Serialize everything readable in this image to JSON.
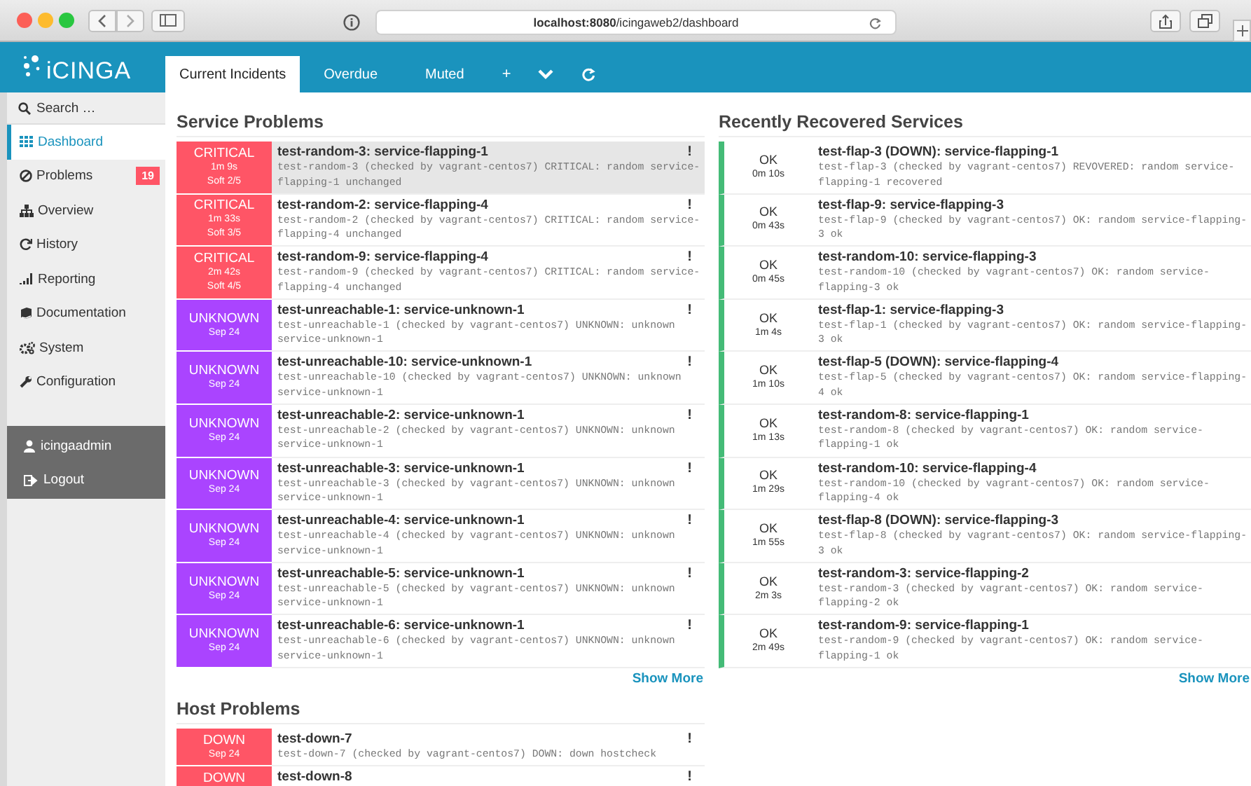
{
  "browser": {
    "url": "**localhost:8080**/icingaweb2/dashboard"
  },
  "header": {
    "logo": "iCINGA",
    "tabs": [
      {
        "label": "Current Incidents",
        "selected": true
      },
      {
        "label": "Overdue",
        "selected": false
      },
      {
        "label": "Muted",
        "selected": false
      }
    ],
    "add_tab": "+"
  },
  "sidebar": {
    "search": {
      "placeholder": "Search …"
    },
    "items": [
      {
        "label": "Dashboard",
        "selected": true
      },
      {
        "label": "Problems",
        "selected": false,
        "badge": "19"
      },
      {
        "label": "Overview",
        "selected": false
      },
      {
        "label": "History",
        "selected": false
      },
      {
        "label": "Reporting",
        "selected": false
      },
      {
        "label": "Documentation",
        "selected": false
      },
      {
        "label": "System",
        "selected": false
      },
      {
        "label": "Configuration",
        "selected": false
      }
    ],
    "user_items": [
      {
        "label": "icingaadmin"
      },
      {
        "label": "Logout"
      }
    ]
  },
  "service_problems": {
    "title": "Service Problems",
    "rows": [
      {
        "kind": "critical",
        "state": "CRITICAL",
        "since": "1m 9s",
        "attempt": "Soft 2/5",
        "title": "test-random-3: service-flapping-1",
        "output": "test-random-3 (checked by vagrant-centos7) CRITICAL: random service-flapping-1 unchanged",
        "flag": "!",
        "selected": true
      },
      {
        "kind": "critical",
        "state": "CRITICAL",
        "since": "1m 33s",
        "attempt": "Soft 3/5",
        "title": "test-random-2: service-flapping-4",
        "output": "test-random-2 (checked by vagrant-centos7) CRITICAL: random service-flapping-4 unchanged",
        "flag": "!",
        "selected": false
      },
      {
        "kind": "critical",
        "state": "CRITICAL",
        "since": "2m 42s",
        "attempt": "Soft 4/5",
        "title": "test-random-9: service-flapping-4",
        "output": "test-random-9 (checked by vagrant-centos7) CRITICAL: random service-flapping-4 unchanged",
        "flag": "!",
        "selected": false
      },
      {
        "kind": "unknown",
        "state": "UNKNOWN",
        "since": "Sep 24",
        "title": "test-unreachable-1: service-unknown-1",
        "output": "test-unreachable-1 (checked by vagrant-centos7) UNKNOWN: unknown service-unknown-1",
        "flag": "!",
        "selected": false
      },
      {
        "kind": "unknown",
        "state": "UNKNOWN",
        "since": "Sep 24",
        "title": "test-unreachable-10: service-unknown-1",
        "output": "test-unreachable-10 (checked by vagrant-centos7) UNKNOWN: unknown service-unknown-1",
        "flag": "!",
        "selected": false
      },
      {
        "kind": "unknown",
        "state": "UNKNOWN",
        "since": "Sep 24",
        "title": "test-unreachable-2: service-unknown-1",
        "output": "test-unreachable-2 (checked by vagrant-centos7) UNKNOWN: unknown service-unknown-1",
        "flag": "!",
        "selected": false
      },
      {
        "kind": "unknown",
        "state": "UNKNOWN",
        "since": "Sep 24",
        "title": "test-unreachable-3: service-unknown-1",
        "output": "test-unreachable-3 (checked by vagrant-centos7) UNKNOWN: unknown service-unknown-1",
        "flag": "!",
        "selected": false
      },
      {
        "kind": "unknown",
        "state": "UNKNOWN",
        "since": "Sep 24",
        "title": "test-unreachable-4: service-unknown-1",
        "output": "test-unreachable-4 (checked by vagrant-centos7) UNKNOWN: unknown service-unknown-1",
        "flag": "!",
        "selected": false
      },
      {
        "kind": "unknown",
        "state": "UNKNOWN",
        "since": "Sep 24",
        "title": "test-unreachable-5: service-unknown-1",
        "output": "test-unreachable-5 (checked by vagrant-centos7) UNKNOWN: unknown service-unknown-1",
        "flag": "!",
        "selected": false
      },
      {
        "kind": "unknown",
        "state": "UNKNOWN",
        "since": "Sep 24",
        "title": "test-unreachable-6: service-unknown-1",
        "output": "test-unreachable-6 (checked by vagrant-centos7) UNKNOWN: unknown service-unknown-1",
        "flag": "!",
        "selected": false
      }
    ],
    "show_more": "Show More"
  },
  "recovered_services": {
    "title": "Recently Recovered Services",
    "rows": [
      {
        "kind": "ok",
        "state": "OK",
        "since": "0m 10s",
        "title": "test-flap-3 (DOWN): service-flapping-1",
        "output": "test-flap-3 (checked by vagrant-centos7) REVOVERED: random service-flapping-1 recovered"
      },
      {
        "kind": "ok",
        "state": "OK",
        "since": "0m 43s",
        "title": "test-flap-9: service-flapping-3",
        "output": "test-flap-9 (checked by vagrant-centos7) OK: random service-flapping-3 ok"
      },
      {
        "kind": "ok",
        "state": "OK",
        "since": "0m 45s",
        "title": "test-random-10: service-flapping-3",
        "output": "test-random-10 (checked by vagrant-centos7) OK: random service-flapping-3 ok"
      },
      {
        "kind": "ok",
        "state": "OK",
        "since": "1m 4s",
        "title": "test-flap-1: service-flapping-3",
        "output": "test-flap-1 (checked by vagrant-centos7) OK: random service-flapping-3 ok"
      },
      {
        "kind": "ok",
        "state": "OK",
        "since": "1m 10s",
        "title": "test-flap-5 (DOWN): service-flapping-4",
        "output": "test-flap-5 (checked by vagrant-centos7) OK: random service-flapping-4 ok"
      },
      {
        "kind": "ok",
        "state": "OK",
        "since": "1m 13s",
        "title": "test-random-8: service-flapping-1",
        "output": "test-random-8 (checked by vagrant-centos7) OK: random service-flapping-1 ok"
      },
      {
        "kind": "ok",
        "state": "OK",
        "since": "1m 29s",
        "title": "test-random-10: service-flapping-4",
        "output": "test-random-10 (checked by vagrant-centos7) OK: random service-flapping-4 ok"
      },
      {
        "kind": "ok",
        "state": "OK",
        "since": "1m 55s",
        "title": "test-flap-8 (DOWN): service-flapping-3",
        "output": "test-flap-8 (checked by vagrant-centos7) OK: random service-flapping-3 ok"
      },
      {
        "kind": "ok",
        "state": "OK",
        "since": "2m 3s",
        "title": "test-random-3: service-flapping-2",
        "output": "test-random-3 (checked by vagrant-centos7) OK: random service-flapping-2 ok"
      },
      {
        "kind": "ok",
        "state": "OK",
        "since": "2m 49s",
        "title": "test-random-9: service-flapping-1",
        "output": "test-random-9 (checked by vagrant-centos7) OK: random service-flapping-1 ok"
      }
    ],
    "show_more": "Show More"
  },
  "host_problems": {
    "title": "Host Problems",
    "rows": [
      {
        "kind": "down",
        "state": "DOWN",
        "since": "Sep 24",
        "title": "test-down-7",
        "output": "test-down-7 (checked by vagrant-centos7) DOWN: down hostcheck",
        "flag": "!"
      },
      {
        "kind": "down",
        "state": "DOWN",
        "title": "test-down-8",
        "flag": "!"
      }
    ]
  }
}
